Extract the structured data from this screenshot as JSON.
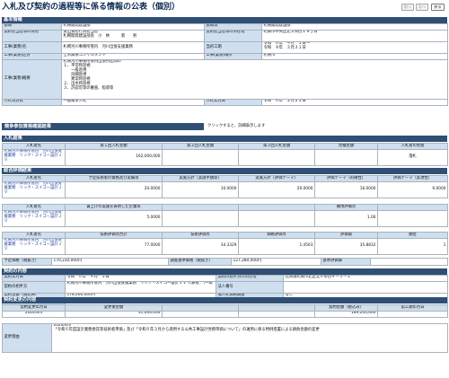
{
  "page": {
    "title": "入札及び契約の過程等に係る情報の公表（個別）"
  },
  "nav": {
    "prev": "前へ",
    "next": "次へ",
    "back": "戻る"
  },
  "basic": {
    "heading": "基本情報",
    "rows": [
      {
        "l1": "部局",
        "v1": "札幌開発建設部",
        "l2": "部局等",
        "v2": "札幌開発建設部"
      },
      {
        "l1": "契約担当官等の氏名",
        "v1": "支出負担行為担当官\n札幌開発建設部長　小　林　　　新　　男",
        "l2": "契約担当官等の所在地",
        "v2": "札幌市中央区北２条西１９丁目"
      },
      {
        "l1": "工事(業務)名",
        "v1": "札幌河川事務所管内　河川出張支援業務",
        "l2": "当初工期",
        "v2": "令和　６年　４月　１日～\n令和　９年　３月３１日"
      },
      {
        "l1": "工事(業務)区分",
        "v1": "土木関係コンサルタント",
        "l2": "工事(業務)場所",
        "v2": "札幌市"
      },
      {
        "l1": "工事(業務)概要",
        "v1": "札幌河川事務所管内出張所区間の\n１、平常時巡視\n　　一般巡視\n　　詳細巡視\n　　異常時巡視\n２、出水時巡視\n３、許認可等の審査、指導等"
      },
      {
        "l1": "入札等方式",
        "v1": "一般競争入札",
        "l2": "入札年月日",
        "v2": "令和　６年　２月２２日"
      }
    ]
  },
  "competition": {
    "heading": "競争参加資格確認結果",
    "hint": "クリックすると、詳細表示します"
  },
  "bid": {
    "heading": "入札結果",
    "headers": [
      "入札者名",
      "第１回入札金額",
      "第２回入札金額",
      "第３回入札金額",
      "見積金額",
      "入札者の状態"
    ],
    "rows": [
      {
        "name": "札幌河川事務所管内　河川出張支援業務　リック・スイコー設計ＪＶ",
        "a1": "162,000,000",
        "a2": "",
        "a3": "",
        "est": "",
        "status": "落札"
      }
    ]
  },
  "evaluation": {
    "heading": "総合評価結果",
    "t1": {
      "headers": [
        "入札者名",
        "予定技術者の資格及び実績等",
        "実施方針（実施手順等）",
        "実施方針（評価テーマ）",
        "評価テーマ（的確性）",
        "評価テーマ（実現性）"
      ],
      "rows": [
        {
          "name": "札幌河川事務所管内　河川出張支援業務　リック・スイコー設計ＪＶ",
          "c1": "20.0000",
          "c2": "10.0000",
          "c3": "20.0000",
          "c4": "16.0000",
          "c5": "6.0000"
        }
      ]
    },
    "t2": {
      "headers": [
        "入札者名",
        "賃上げの実施を表明した企業等",
        "",
        "",
        "費用評価点",
        ""
      ],
      "rows": [
        {
          "name": "札幌河川事務所管内　河川出張支援業務　リック・スイコー設計ＪＶ",
          "c1": "5.0000",
          "c2": "",
          "c3": "",
          "c4": "1.00",
          "c5": ""
        }
      ]
    },
    "t3": {
      "headers": [
        "入札者名",
        "技術評価点合計",
        "技術評価点",
        "価格評価点",
        "評価値",
        "順位"
      ],
      "rows": [
        {
          "name": "札幌河川事務所管内　河川出張支援業務　リック・スイコー設計ＪＶ",
          "c1": "77.0000",
          "c2": "34.3329",
          "c3": "1.4563",
          "c4": "35.8832",
          "c5": "1"
        }
      ]
    }
  },
  "price": {
    "planned_label": "予定価格（税抜き）",
    "planned": "170,230,000円",
    "base_label": "調査基準価格（税抜き）",
    "base": "127,280,000円",
    "low_label": "基準評価価"
  },
  "contract": {
    "heading": "契約の内容",
    "rows": [
      {
        "l1": "契約年月日",
        "v1": "令和　６年　４月　１日",
        "l2": "契約の相手方の所在地",
        "v2": "北海道札幌市北区北６条西４－５－１"
      },
      {
        "l1": "契約の相手方",
        "v1": "札幌河川事務所管内　河川出張支援業務　リック・スイコー設計ＪＶ 代表者：（一財",
        "l2": "法人番号",
        "v2": ""
      },
      {
        "l1": "契約金額（税込み）",
        "v1": "178,200,000円",
        "l2": "低入札価格調査",
        "v2": "なし"
      },
      {
        "l1": "随意契約によることとした理由",
        "v1": ""
      }
    ]
  },
  "changes": {
    "heading": "契約変更の内容",
    "headers": [
      "契約変更年月日",
      "変更後金額",
      "",
      "",
      "契約金額（税込み）",
      "前工期年月日"
    ],
    "rows": [
      {
        "date": "2024/6/3",
        "after": "31,000,000",
        "c2": "",
        "c3": "",
        "amount": "189,200,000",
        "prev": ""
      }
    ],
    "reason_label": "変更理由",
    "reason": "2024/6/3\n「令和６年度設計業務委託等技術者単価」及び「令和６年３月から適用する公共工事設計労務単価について」の運用に係る特例措置による請負金額の変更"
  }
}
